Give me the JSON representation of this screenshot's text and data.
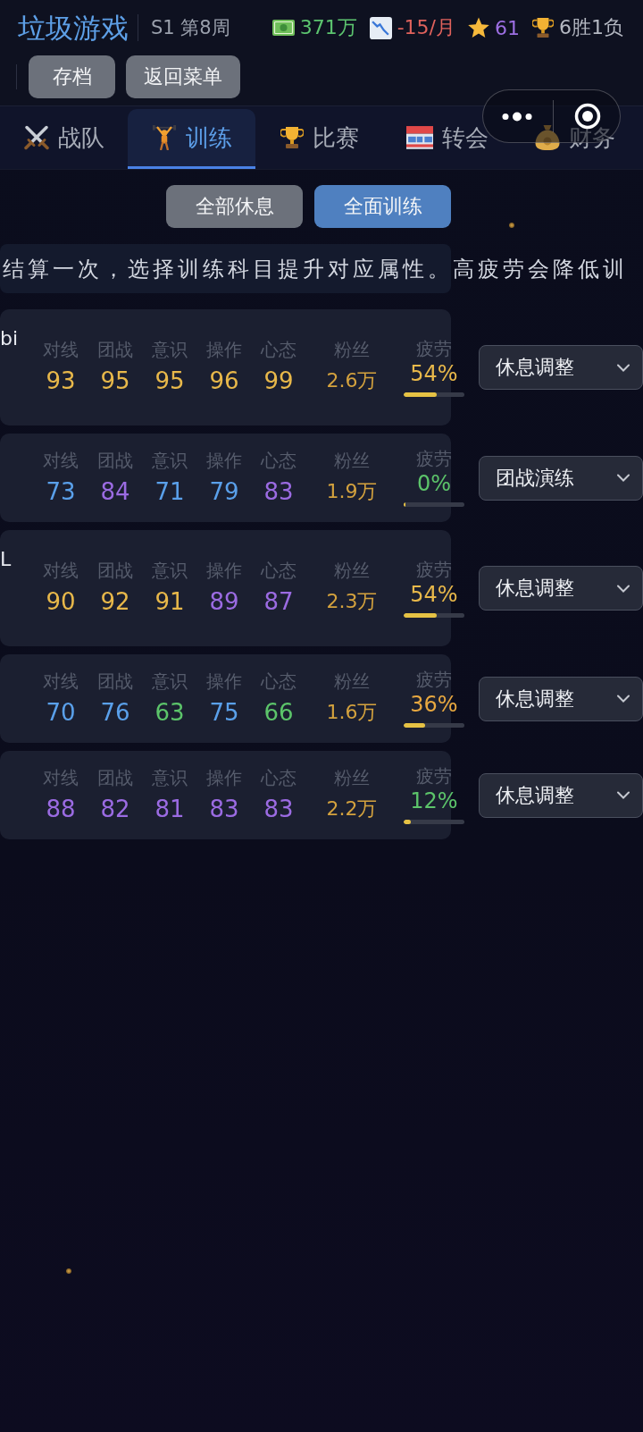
{
  "header": {
    "title": "垃圾游戏",
    "season": "S1 第8周",
    "stats": [
      {
        "kind": "money",
        "value": "371万",
        "color": "#5cc46f"
      },
      {
        "kind": "trend",
        "value": "-15/月",
        "color": "#e0625c"
      },
      {
        "kind": "star",
        "value": "61",
        "color": "#9d6fe3"
      },
      {
        "kind": "trophy",
        "value": "6胜1负",
        "color": "#b4b8c2"
      }
    ],
    "buttons": [
      "存档",
      "返回菜单"
    ]
  },
  "tabs": [
    {
      "kind": "team",
      "label": "战队",
      "selected": false
    },
    {
      "kind": "training",
      "label": "训练",
      "selected": true
    },
    {
      "kind": "match",
      "label": "比赛",
      "selected": false
    },
    {
      "kind": "transfer",
      "label": "转会",
      "selected": false
    },
    {
      "kind": "finance",
      "label": "财务",
      "selected": false
    }
  ],
  "actions": [
    {
      "kind": "secondary",
      "label": "全部休息"
    },
    {
      "kind": "primary",
      "label": "全面训练"
    }
  ],
  "info_text": "结算一次，选择训练科目提升对应属性。高疲劳会降低训",
  "players": [
    {
      "name": "bi",
      "stats": [
        {
          "label": "对线",
          "value": "93",
          "color": "#e8b84a"
        },
        {
          "label": "团战",
          "value": "95",
          "color": "#e8b84a"
        },
        {
          "label": "意识",
          "value": "95",
          "color": "#e8b84a"
        },
        {
          "label": "操作",
          "value": "96",
          "color": "#e8b84a"
        },
        {
          "label": "心态",
          "value": "99",
          "color": "#e8b84a"
        }
      ],
      "fans": {
        "label": "粉丝",
        "value": "2.6万"
      },
      "fatigue": {
        "label": "疲劳",
        "value": "54%",
        "color": "#e8b84a",
        "level": 0.54
      },
      "training": "休息调整"
    },
    {
      "stats": [
        {
          "label": "对线",
          "value": "73",
          "color": "#5aa0ea"
        },
        {
          "label": "团战",
          "value": "84",
          "color": "#9b6be2"
        },
        {
          "label": "意识",
          "value": "71",
          "color": "#5aa0ea"
        },
        {
          "label": "操作",
          "value": "79",
          "color": "#5aa0ea"
        },
        {
          "label": "心态",
          "value": "83",
          "color": "#9b6be2"
        }
      ],
      "fans": {
        "label": "粉丝",
        "value": "1.9万"
      },
      "fatigue": {
        "label": "疲劳",
        "value": "0%",
        "color": "#5cc46a",
        "level": 0
      },
      "training": "团战演练"
    },
    {
      "name": "L",
      "stats": [
        {
          "label": "对线",
          "value": "90",
          "color": "#e8b84a"
        },
        {
          "label": "团战",
          "value": "92",
          "color": "#e8b84a"
        },
        {
          "label": "意识",
          "value": "91",
          "color": "#e8b84a"
        },
        {
          "label": "操作",
          "value": "89",
          "color": "#9b6be2"
        },
        {
          "label": "心态",
          "value": "87",
          "color": "#9b6be2"
        }
      ],
      "fans": {
        "label": "粉丝",
        "value": "2.3万"
      },
      "fatigue": {
        "label": "疲劳",
        "value": "54%",
        "color": "#e8b84a",
        "level": 0.54
      },
      "training": "休息调整"
    },
    {
      "stats": [
        {
          "label": "对线",
          "value": "70",
          "color": "#5aa0ea"
        },
        {
          "label": "团战",
          "value": "76",
          "color": "#5aa0ea"
        },
        {
          "label": "意识",
          "value": "63",
          "color": "#5cc46a"
        },
        {
          "label": "操作",
          "value": "75",
          "color": "#5aa0ea"
        },
        {
          "label": "心态",
          "value": "66",
          "color": "#5cc46a"
        }
      ],
      "fans": {
        "label": "粉丝",
        "value": "1.6万"
      },
      "fatigue": {
        "label": "疲劳",
        "value": "36%",
        "color": "#e8a840",
        "level": 0.36
      },
      "training": "休息调整"
    },
    {
      "stats": [
        {
          "label": "对线",
          "value": "88",
          "color": "#9b6be2"
        },
        {
          "label": "团战",
          "value": "82",
          "color": "#9b6be2"
        },
        {
          "label": "意识",
          "value": "81",
          "color": "#9b6be2"
        },
        {
          "label": "操作",
          "value": "83",
          "color": "#9b6be2"
        },
        {
          "label": "心态",
          "value": "83",
          "color": "#9b6be2"
        }
      ],
      "fans": {
        "label": "粉丝",
        "value": "2.2万"
      },
      "fatigue": {
        "label": "疲劳",
        "value": "12%",
        "color": "#5cc46a",
        "level": 0.12
      },
      "training": "休息调整"
    }
  ]
}
